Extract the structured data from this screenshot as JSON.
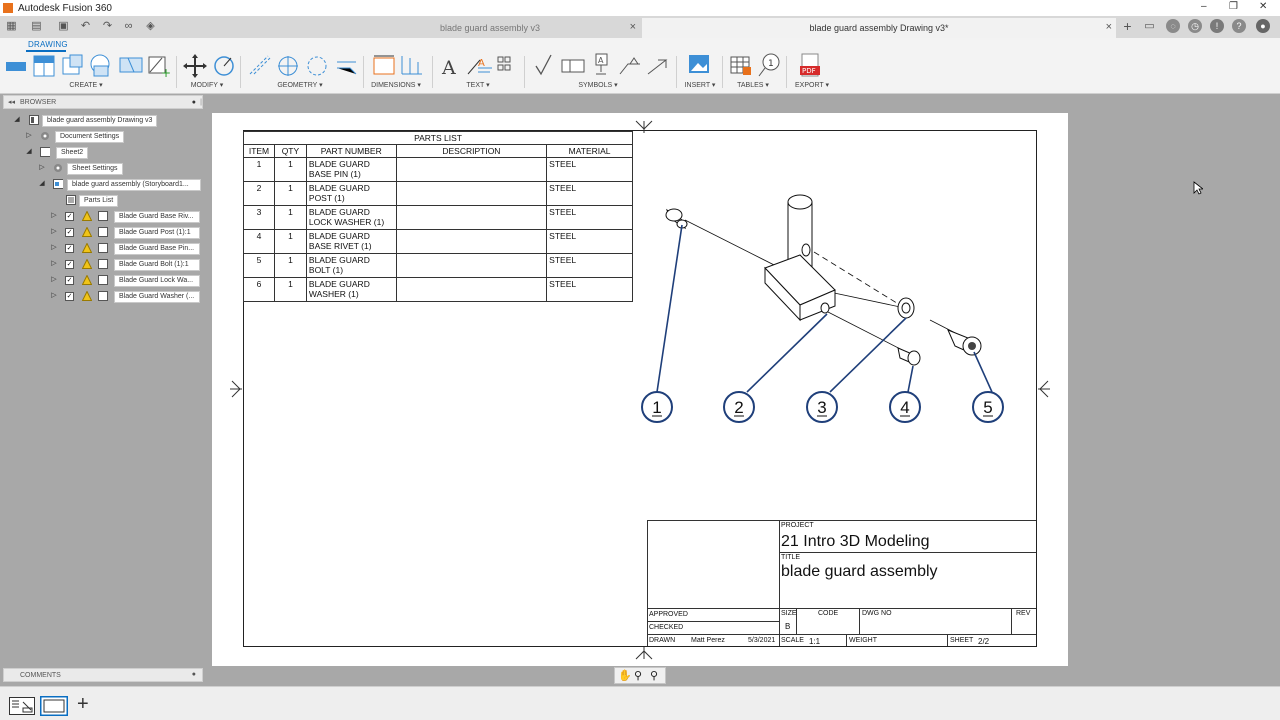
{
  "window": {
    "title": "Autodesk Fusion 360",
    "controls": [
      "–",
      "❐",
      "✕"
    ]
  },
  "tabs": [
    {
      "label": "blade guard assembly v3",
      "active": false
    },
    {
      "label": "blade guard assembly Drawing v3*",
      "active": true
    }
  ],
  "ribbon": {
    "workspace": "DRAWING",
    "groups": [
      "CREATE ▾",
      "MODIFY ▾",
      "GEOMETRY ▾",
      "DIMENSIONS ▾",
      "TEXT ▾",
      "SYMBOLS ▾",
      "INSERT ▾",
      "TABLES ▾",
      "EXPORT ▾"
    ]
  },
  "browser": {
    "header": "BROWSER",
    "root": "blade guard assembly Drawing v3",
    "document_settings": "Document Settings",
    "sheet": "Sheet2",
    "sheet_settings": "Sheet Settings",
    "view": "blade guard assembly (Storyboard1...",
    "parts_list": "Parts List",
    "components": [
      "Blade Guard Base Riv...",
      "Blade Guard Post (1):1",
      "Blade Guard Base Pin...",
      "Blade Guard Bolt (1):1",
      "Blade Guard Lock Wa...",
      "Blade Guard Washer (..."
    ]
  },
  "comments": {
    "label": "COMMENTS"
  },
  "parts_list": {
    "title": "PARTS LIST",
    "headers": [
      "ITEM",
      "QTY",
      "PART NUMBER",
      "DESCRIPTION",
      "MATERIAL"
    ],
    "rows": [
      {
        "item": "1",
        "qty": "1",
        "part": "BLADE GUARD BASE PIN (1)",
        "desc": "",
        "material": "STEEL"
      },
      {
        "item": "2",
        "qty": "1",
        "part": "BLADE GUARD POST (1)",
        "desc": "",
        "material": "STEEL"
      },
      {
        "item": "3",
        "qty": "1",
        "part": "BLADE GUARD LOCK WASHER (1)",
        "desc": "",
        "material": "STEEL"
      },
      {
        "item": "4",
        "qty": "1",
        "part": "BLADE GUARD BASE RIVET (1)",
        "desc": "",
        "material": "STEEL"
      },
      {
        "item": "5",
        "qty": "1",
        "part": "BLADE GUARD BOLT (1)",
        "desc": "",
        "material": "STEEL"
      },
      {
        "item": "6",
        "qty": "1",
        "part": "BLADE GUARD WASHER (1)",
        "desc": "",
        "material": "STEEL"
      }
    ]
  },
  "balloons": [
    "1",
    "2",
    "3",
    "4",
    "5"
  ],
  "title_block": {
    "project_label": "PROJECT",
    "project": "21 Intro 3D Modeling",
    "title_label": "TITLE",
    "title": "blade guard assembly",
    "approved_label": "APPROVED",
    "checked_label": "CHECKED",
    "drawn_label": "DRAWN",
    "drawn_by": "Matt Perez",
    "drawn_date": "5/3/2021",
    "size_label": "SIZE",
    "size": "B",
    "code_label": "CODE",
    "dwg_label": "DWG NO",
    "rev_label": "REV",
    "scale_label": "SCALE",
    "scale": "1:1",
    "weight_label": "WEIGHT",
    "sheet_label": "SHEET",
    "sheet": "2/2"
  },
  "colors": {
    "accent": "#0a6ec2",
    "balloon": "#1f3f7a",
    "workspace_bg": "#a8a8a8"
  }
}
